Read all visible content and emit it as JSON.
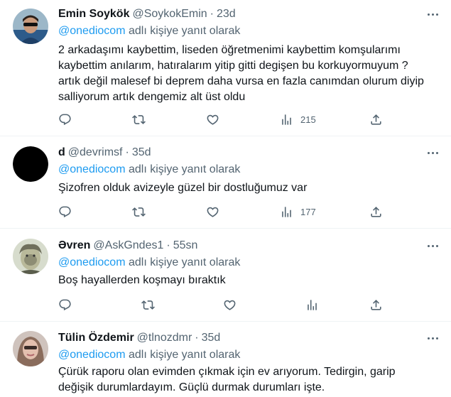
{
  "colors": {
    "link": "#1d9bf0",
    "muted": "#536471",
    "text": "#0f1419",
    "divider": "#eff3f4"
  },
  "icons": {
    "reply": "reply-icon",
    "retweet": "retweet-icon",
    "like": "like-icon",
    "views": "views-icon",
    "share": "share-icon",
    "more": "more-icon"
  },
  "tweets": [
    {
      "name": "Emin Soykök",
      "handle": "@SoykokEmin",
      "separator": "·",
      "time": "23d",
      "reply_to": "@onediocom",
      "reply_suffix": "adlı kişiye yanıt olarak",
      "lines": [
        "2 arkadaşımı kaybettim, liseden öğretmenimi kaybettim komşularımı",
        "kaybettim anılarım, hatıralarım yitip gitti degişen bu korkuyormuyum ?",
        "artık değil  malesef bi deprem daha vursa en fazla canımdan olurum diyip",
        "salliyorum artık dengemiz alt üst oldu"
      ],
      "views": "215"
    },
    {
      "name": "d",
      "handle": "@devrimsf",
      "separator": "·",
      "time": "35d",
      "reply_to": "@onediocom",
      "reply_suffix": "adlı kişiye yanıt olarak",
      "lines": [
        "Şizofren olduk avizeyle güzel bir dostluğumuz var"
      ],
      "views": "177"
    },
    {
      "name": "Əvren",
      "handle": "@AskGndes1",
      "separator": "·",
      "time": "55sn",
      "reply_to": "@onediocom",
      "reply_suffix": "adlı kişiye yanıt olarak",
      "lines": [
        "Boş hayallerden koşmayı bıraktık"
      ],
      "views": ""
    },
    {
      "name": "Tülin Özdemir",
      "handle": "@tlnozdmr",
      "separator": "·",
      "time": "35d",
      "reply_to": "@onediocom",
      "reply_suffix": "adlı kişiye yanıt olarak",
      "lines": [
        "Çürük raporu olan evimden çıkmak için ev arıyorum. Tedirgin, garip",
        "değişik durumlardayım. Güçlü durmak durumları işte."
      ],
      "views": ""
    }
  ]
}
